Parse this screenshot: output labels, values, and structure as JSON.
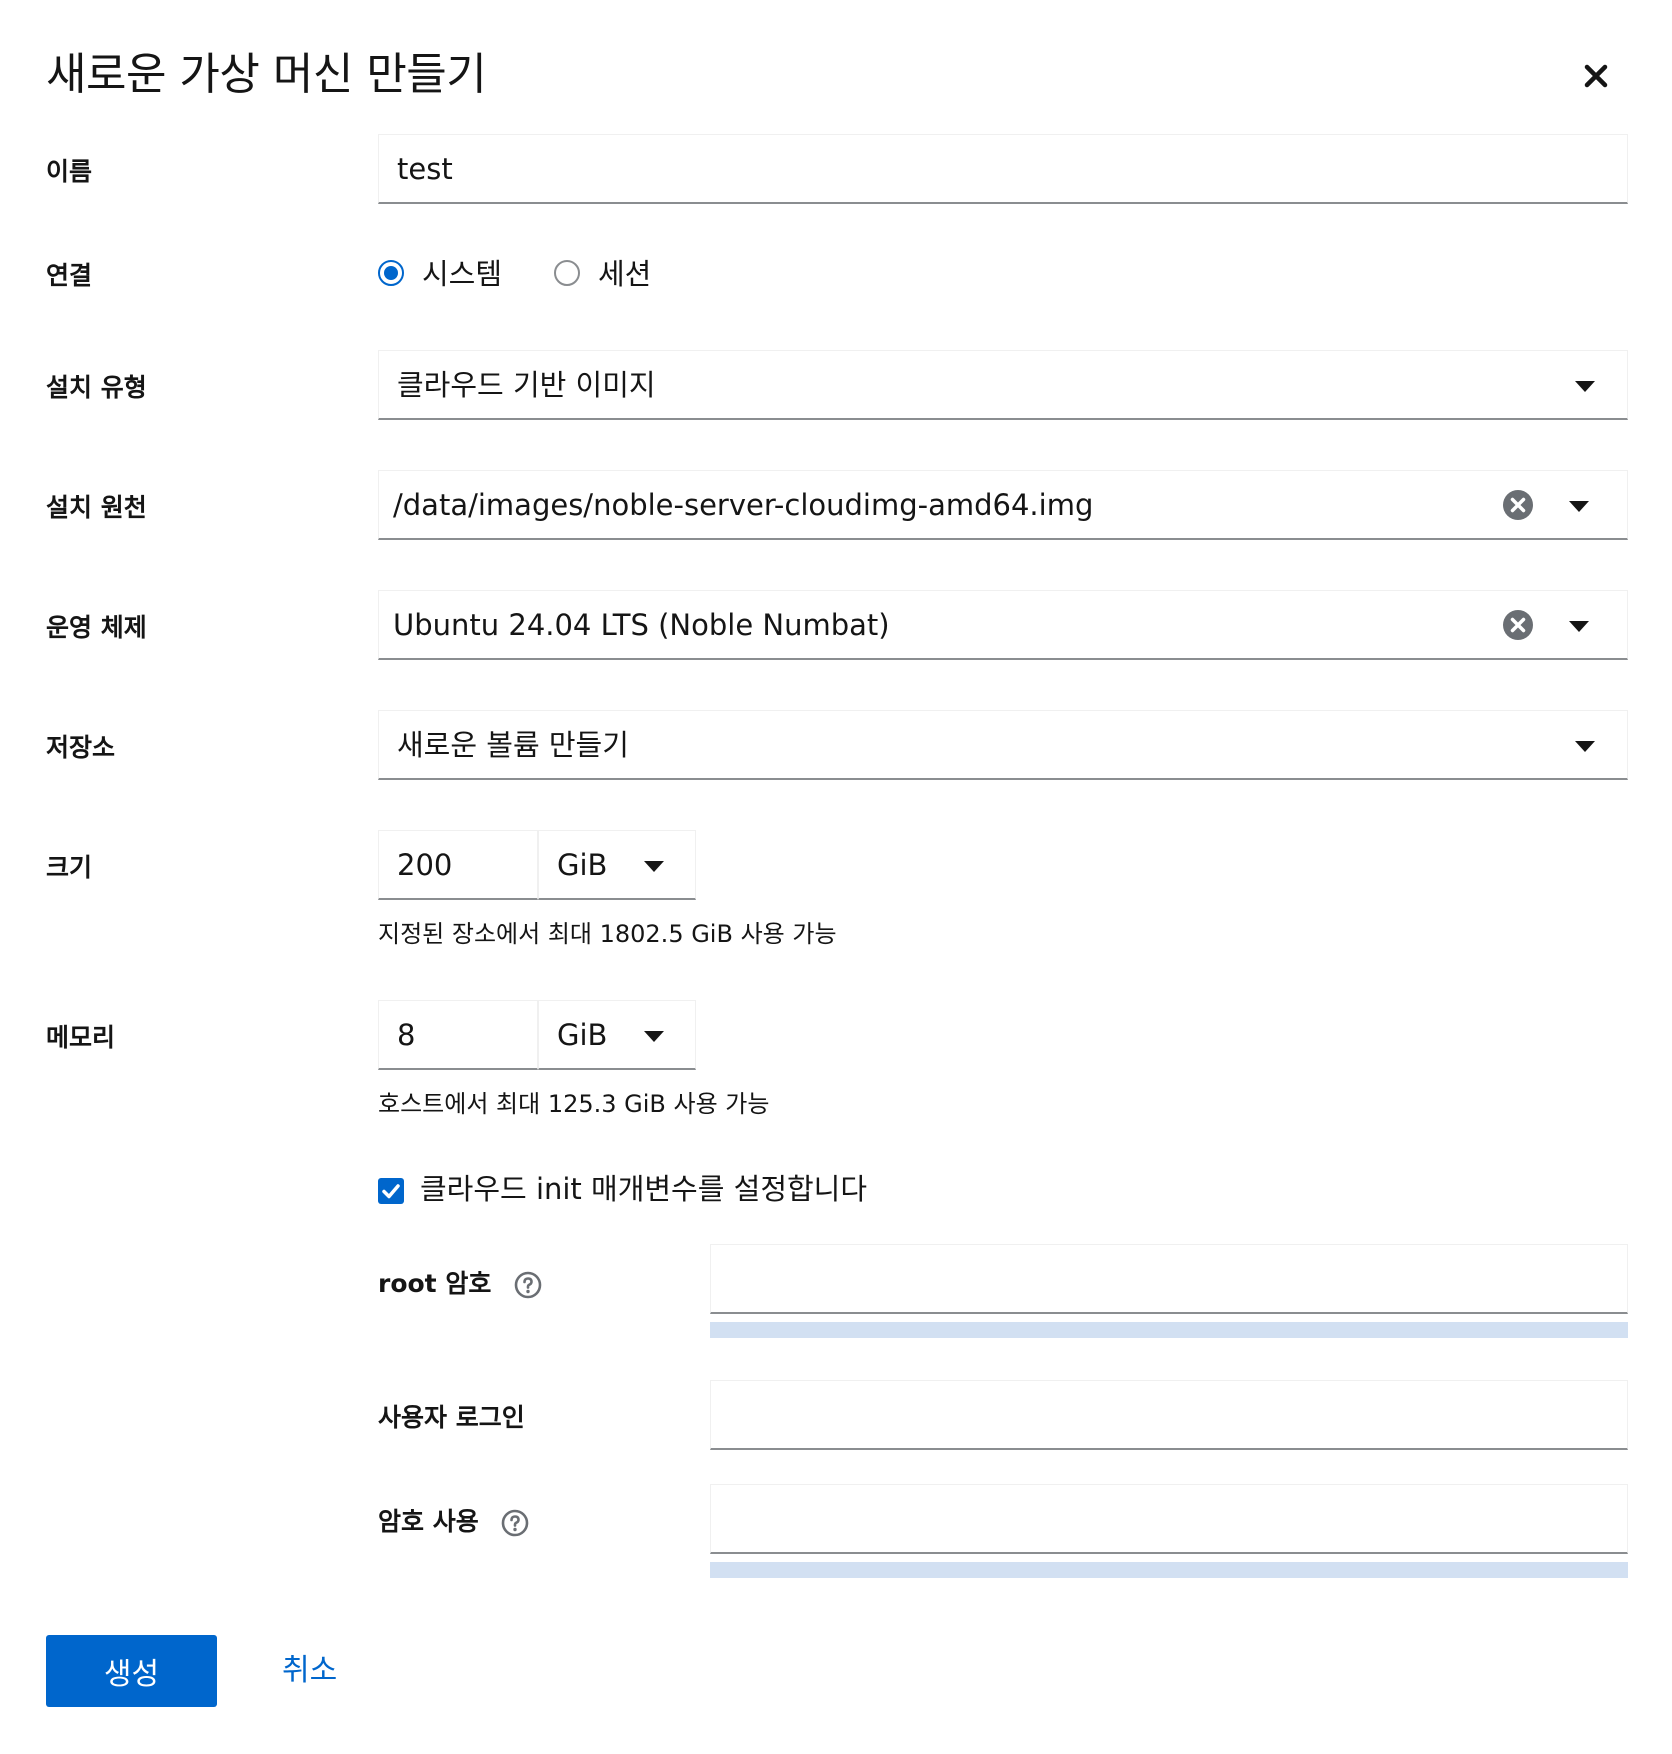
{
  "dialog": {
    "title": "새로운 가상 머신 만들기"
  },
  "colors": {
    "accent": "#0066cc",
    "meter": "#d2e0f2",
    "border": "#8a8d90"
  },
  "fields": {
    "name": {
      "label": "이름",
      "value": "test"
    },
    "connection": {
      "label": "연결",
      "options": [
        "시스템",
        "세션"
      ],
      "selected": "시스템"
    },
    "install_type": {
      "label": "설치 유형",
      "value": "클라우드 기반 이미지"
    },
    "install_source": {
      "label": "설치 원천",
      "value": "/data/images/noble-server-cloudimg-amd64.img"
    },
    "os": {
      "label": "운영 체제",
      "value": "Ubuntu 24.04 LTS (Noble Numbat)"
    },
    "storage": {
      "label": "저장소",
      "value": "새로운 볼륨 만들기"
    },
    "size": {
      "label": "크기",
      "value": "200",
      "unit": "GiB",
      "help": "지정된 장소에서 최대 1802.5 GiB 사용 가능"
    },
    "memory": {
      "label": "메모리",
      "value": "8",
      "unit": "GiB",
      "help": "호스트에서 최대 125.3 GiB 사용 가능"
    }
  },
  "cloud_init": {
    "checkbox_label": "클라우드 init 매개변수를 설정합니다",
    "checked": true,
    "root_password": {
      "label": "root 암호",
      "value": ""
    },
    "user_login": {
      "label": "사용자 로그인",
      "value": ""
    },
    "user_password": {
      "label": "암호 사용",
      "value": ""
    }
  },
  "actions": {
    "create": "생성",
    "cancel": "취소"
  },
  "icons": {
    "close": "close-icon",
    "clear": "clear-circle-icon",
    "caret": "caret-down-icon",
    "help": "question-circle-icon",
    "check": "check-icon"
  }
}
